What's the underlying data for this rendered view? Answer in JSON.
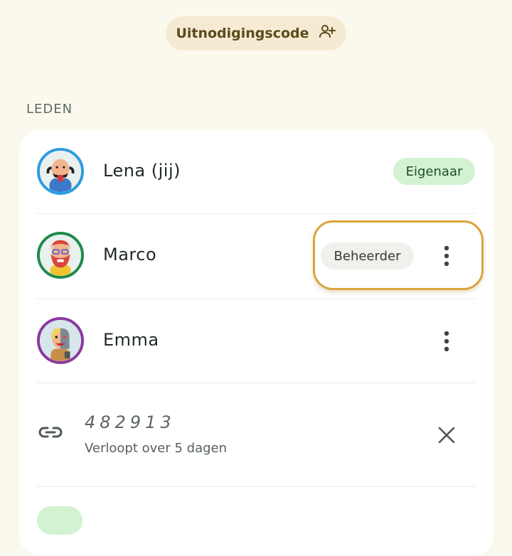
{
  "invite": {
    "label": "Uitnodigingscode",
    "icon": "person-add-icon"
  },
  "members_section": {
    "label": "LEDEN"
  },
  "members": [
    {
      "name": "Lena (jij)",
      "role": "Eigenaar",
      "ring_color": "#2e9be0"
    },
    {
      "name": "Marco",
      "role": "Beheerder",
      "ring_color": "#1f8a4c"
    },
    {
      "name": "Emma",
      "role": "",
      "ring_color": "#8a3a9e"
    }
  ],
  "invite_code": {
    "code": "482913",
    "expires": "Verloopt over 5 dagen",
    "icon": "link-icon",
    "remove_icon": "close-icon"
  },
  "colors": {
    "background": "#fbf9ee",
    "card": "#ffffff",
    "owner_chip": "#d3f2d1",
    "admin_chip": "#f0f1ec",
    "highlight": "#dba43c",
    "invite_button": "#f5ebd2"
  }
}
